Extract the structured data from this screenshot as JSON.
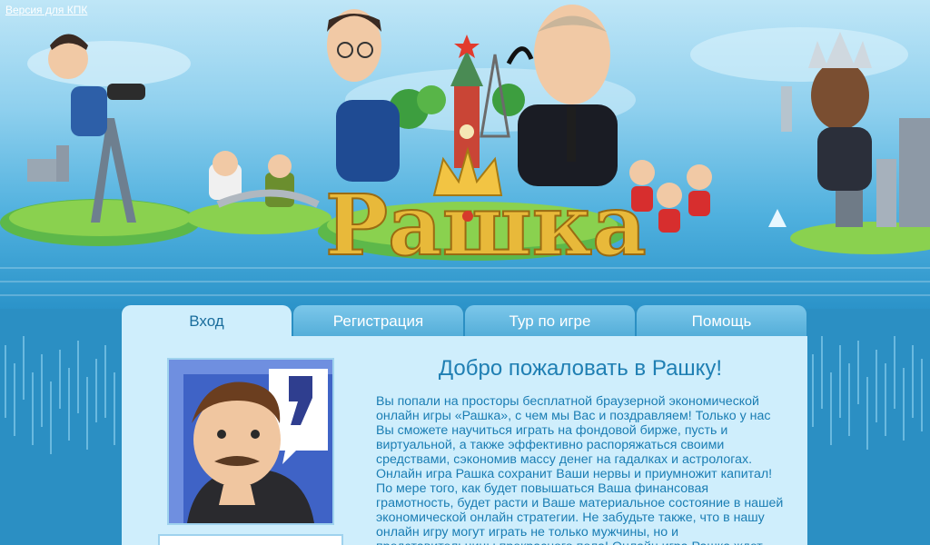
{
  "header": {
    "mobile_link": "Версия для КПК",
    "logo_text": "Рашка"
  },
  "tabs": [
    {
      "label": "Вход",
      "active": true
    },
    {
      "label": "Регистрация",
      "active": false
    },
    {
      "label": "Тур по игре",
      "active": false
    },
    {
      "label": "Помощь",
      "active": false
    }
  ],
  "main": {
    "title": "Добро пожаловать в Рашку!",
    "text": "Вы попали на просторы бесплатной браузерной экономической онлайн игры «Рашка», с чем мы Вас и поздравляем! Только у нас Вы сможете научиться играть на фондовой бирже, пусть и виртуальной, а также эффективно распоряжаться своими средствами, сэкономив массу денег на гадалках и астрологах. Онлайн игра Рашка сохранит Ваши нервы и приумножит капитал! По мере того, как будет повышаться Ваша финансовая грамотность, будет расти и Ваше материальное состояние в нашей экономической онлайн стратегии. Не забудьте также, что в нашу онлайн игру могут играть не только мужчины, но и представительницы прекрасного пола! Онлайн игра Рашка ждет"
  },
  "colors": {
    "sky": "#8fd0ee",
    "sea": "#2b8fc3",
    "panel": "#cfeefc",
    "title": "#1f7fb3",
    "logo_gold": "#e8b93a"
  }
}
